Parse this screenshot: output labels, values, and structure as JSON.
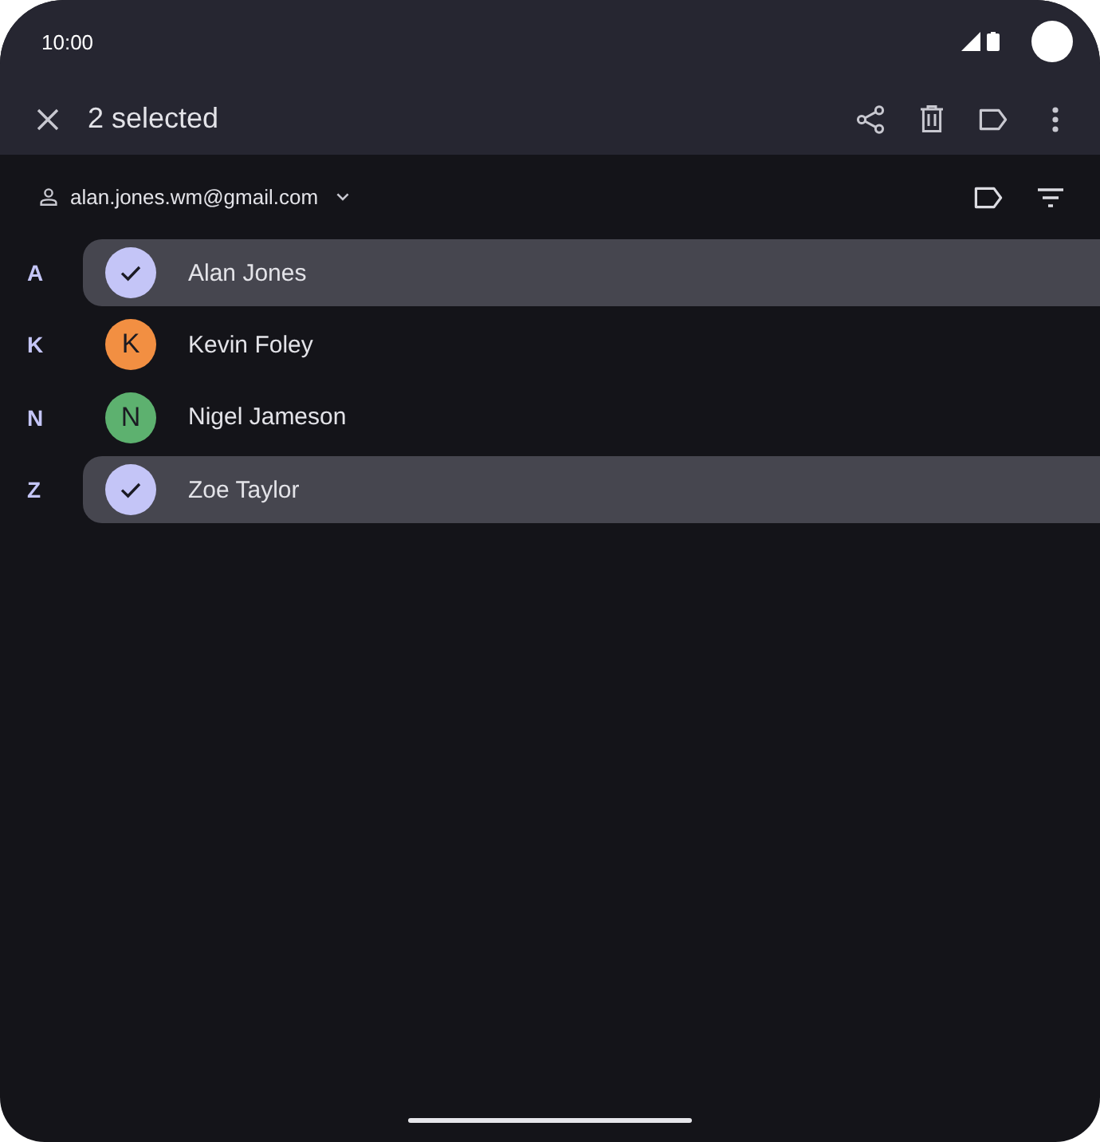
{
  "status_bar": {
    "time": "10:00"
  },
  "app_bar": {
    "title": "2 selected"
  },
  "account": {
    "email": "alan.jones.wm@gmail.com"
  },
  "contacts": [
    {
      "section": "A",
      "name": "Alan Jones",
      "selected": true
    },
    {
      "section": "K",
      "name": "Kevin Foley",
      "selected": false,
      "initial": "K",
      "color": "#f28f42"
    },
    {
      "section": "N",
      "name": "Nigel Jameson",
      "selected": false,
      "initial": "N",
      "color": "#5db16f"
    },
    {
      "section": "Z",
      "name": "Zoe Taylor",
      "selected": true
    }
  ]
}
